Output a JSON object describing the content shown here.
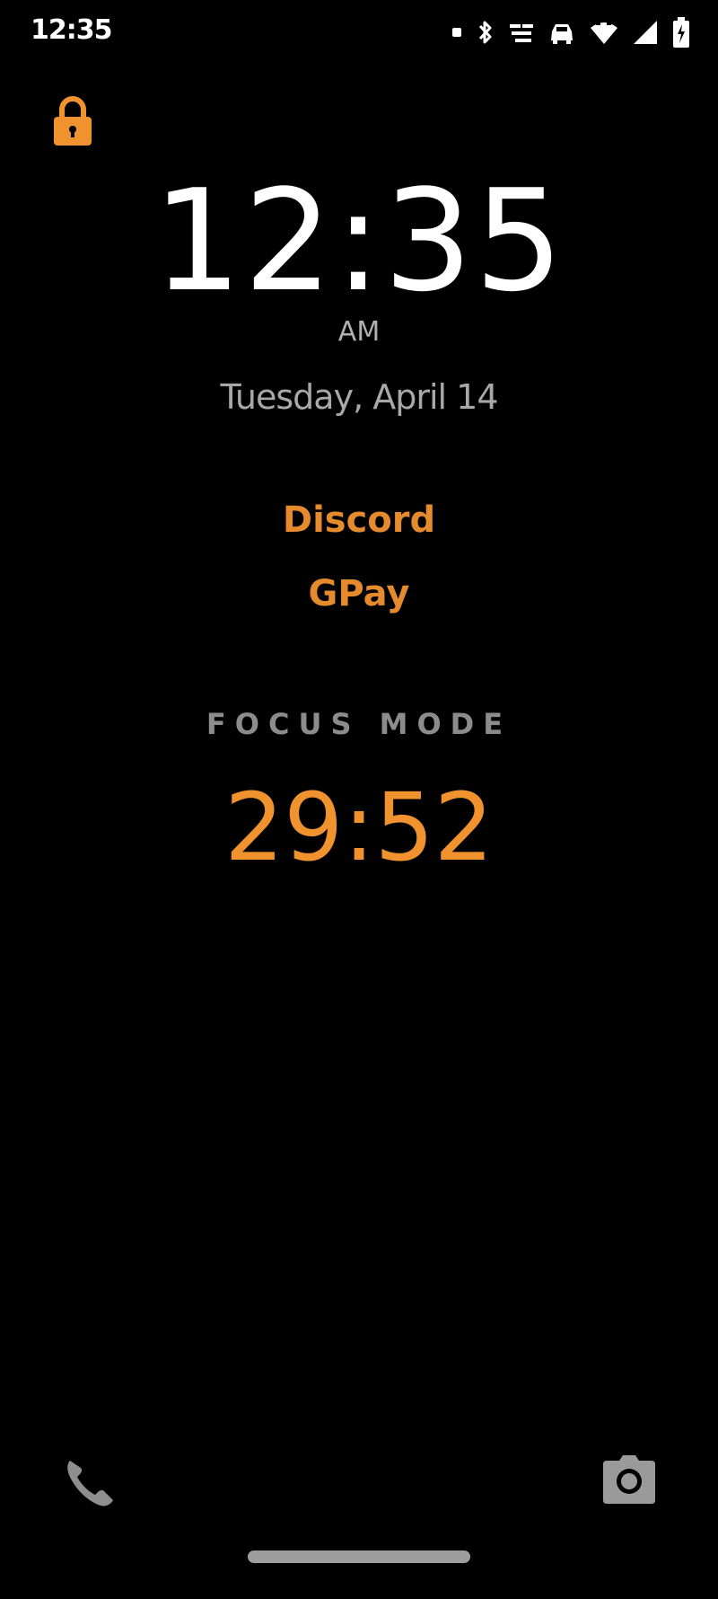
{
  "status_bar": {
    "time": "12:35",
    "icons": [
      "notification-dot-icon",
      "bluetooth-icon",
      "data-speed-icon",
      "car-icon",
      "wifi-icon",
      "signal-icon",
      "battery-icon"
    ]
  },
  "lock_screen": {
    "lock_icon": "lock-icon",
    "clock": "12:35",
    "ampm": "AM",
    "date": "Tuesday, April 14"
  },
  "notifications": [
    {
      "app": "Discord"
    },
    {
      "app": "GPay"
    }
  ],
  "focus_mode": {
    "label": "FOCUS MODE",
    "timer": "29:52"
  },
  "shortcuts": {
    "left": "phone-icon",
    "right": "camera-icon"
  },
  "colors": {
    "accent": "#f0932e",
    "background": "#000000",
    "text_primary": "#ffffff",
    "text_secondary": "#a8a8a8"
  }
}
